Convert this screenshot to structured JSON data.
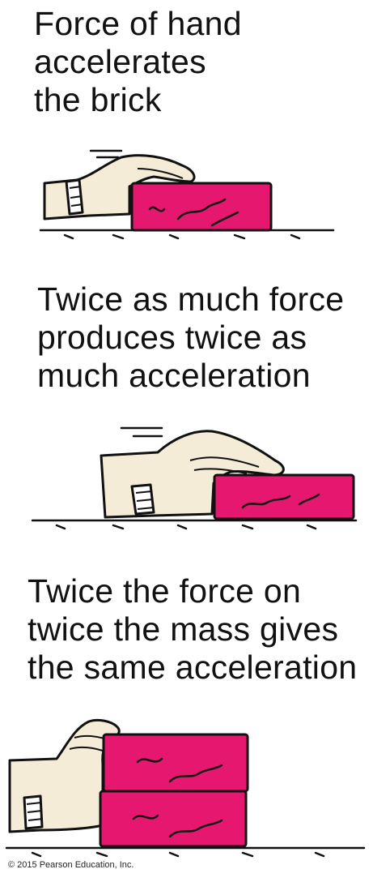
{
  "panels": [
    {
      "caption": [
        "Force of hand",
        "accelerates",
        "the brick"
      ]
    },
    {
      "caption": [
        "Twice as much force",
        "produces twice as",
        "much acceleration"
      ]
    },
    {
      "caption": [
        "Twice the force on",
        "twice the mass gives",
        "the same acceleration"
      ]
    }
  ],
  "copyright": "© 2015 Pearson Education, Inc.",
  "colors": {
    "brick": "#e6176f",
    "brick_shade": "#b50f55",
    "skin": "#f5ecd7",
    "ink": "#111111"
  }
}
